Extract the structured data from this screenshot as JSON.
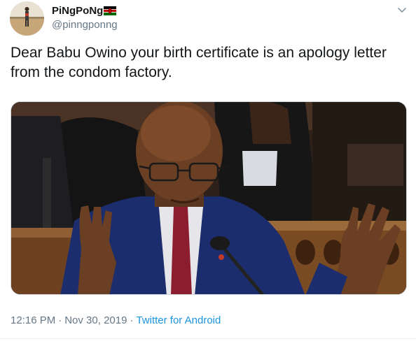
{
  "author": {
    "display_name": "PiNgPoNg",
    "handle": "@pinngponng",
    "flag_icon": "kenya-flag-icon"
  },
  "tweet": {
    "text": "Dear Babu Owino your birth certificate is an apology letter from the condom factory."
  },
  "meta": {
    "time": "12:16 PM",
    "separator": "·",
    "date": "Nov 30, 2019",
    "source": "Twitter for Android"
  },
  "colors": {
    "text": "#14171a",
    "secondary": "#657786",
    "link": "#1b95e0",
    "border": "#e6ecf0"
  },
  "icons": {
    "more": "chevron-down-icon"
  }
}
